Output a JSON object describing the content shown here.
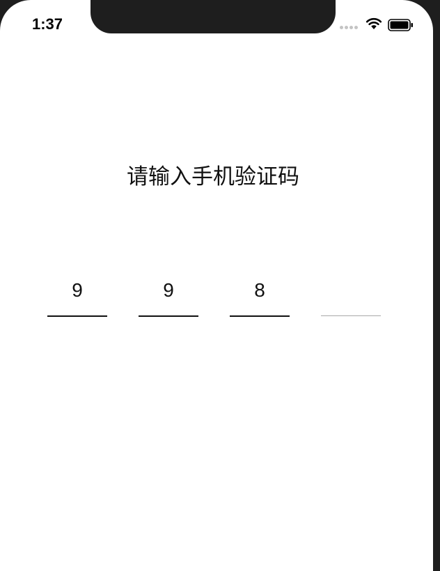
{
  "status_bar": {
    "time": "1:37",
    "signal_icon": "cellular-signal-icon",
    "wifi_icon": "wifi-icon",
    "battery_icon": "battery-icon"
  },
  "page": {
    "title": "请输入手机验证码"
  },
  "code_input": {
    "digits": [
      "9",
      "9",
      "8",
      ""
    ],
    "length": 4,
    "filled": 3
  },
  "colors": {
    "background": "#ffffff",
    "frame": "#1e1e1e",
    "text": "#111111",
    "empty_underline": "#a8a8a8"
  }
}
